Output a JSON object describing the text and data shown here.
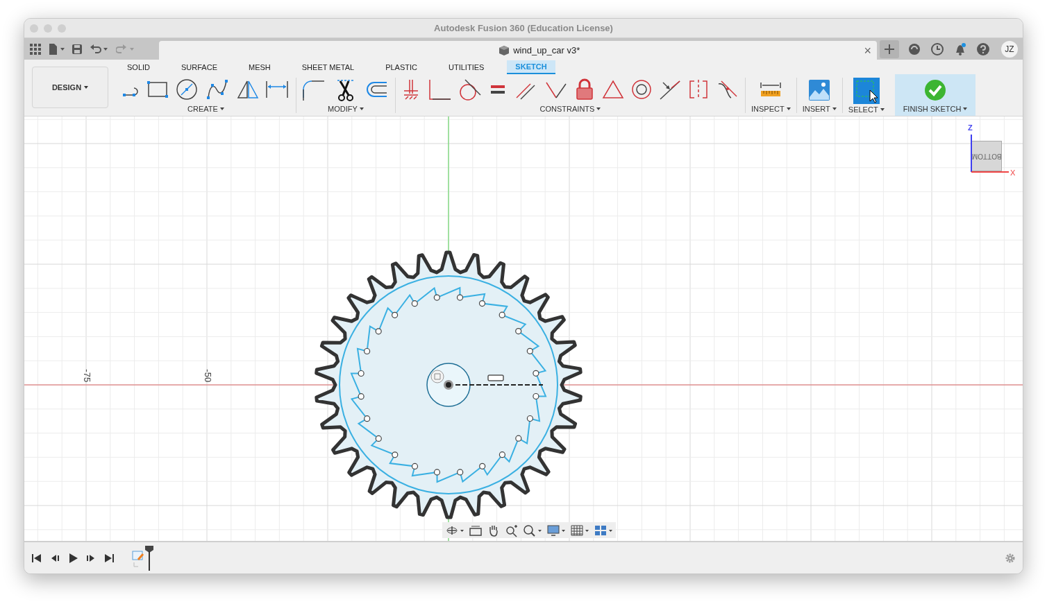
{
  "window": {
    "title": "Autodesk Fusion 360 (Education License)"
  },
  "document_tab": {
    "title": "wind_up_car v3*",
    "close": "×"
  },
  "user": {
    "initials": "JZ"
  },
  "workspace": {
    "label": "DESIGN"
  },
  "tabs": [
    {
      "label": "SOLID",
      "selected": false
    },
    {
      "label": "SURFACE",
      "selected": false
    },
    {
      "label": "MESH",
      "selected": false
    },
    {
      "label": "SHEET METAL",
      "selected": false
    },
    {
      "label": "PLASTIC",
      "selected": false
    },
    {
      "label": "UTILITIES",
      "selected": false
    },
    {
      "label": "SKETCH",
      "selected": true
    }
  ],
  "tool_groups": [
    {
      "label": "CREATE",
      "kind": "tools"
    },
    {
      "label": "MODIFY",
      "kind": "tools"
    },
    {
      "label": "CONSTRAINTS",
      "kind": "tools"
    },
    {
      "label": "INSPECT",
      "kind": "tools"
    },
    {
      "label": "INSERT",
      "kind": "tools"
    },
    {
      "label": "SELECT",
      "kind": "tools"
    },
    {
      "label": "FINISH SKETCH",
      "kind": "finish"
    }
  ],
  "viewport": {
    "axis_labels": [
      "-75",
      "-50"
    ],
    "view_cube": {
      "face": "BOTTOM",
      "z_label": "Z",
      "x_label": "X"
    }
  }
}
